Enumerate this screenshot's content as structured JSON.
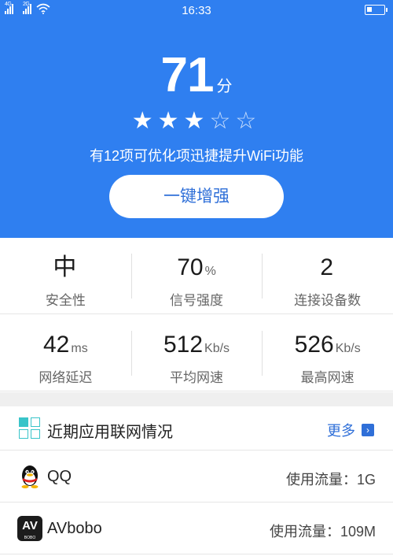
{
  "status_bar": {
    "network_1": "4G",
    "network_2": "2G",
    "time": "16:33"
  },
  "header": {
    "score": "71",
    "score_unit": "分",
    "rating": 3,
    "rating_max": 5,
    "tip": "有12项可优化项迅捷提升WiFi功能",
    "boost_label": "一键增强"
  },
  "stats": {
    "row1": [
      {
        "value": "中",
        "unit": "",
        "label": "安全性"
      },
      {
        "value": "70",
        "unit": "%",
        "label": "信号强度"
      },
      {
        "value": "2",
        "unit": "",
        "label": "连接设备数"
      }
    ],
    "row2": [
      {
        "value": "42",
        "unit": "ms",
        "label": "网络延迟"
      },
      {
        "value": "512",
        "unit": "Kb/s",
        "label": "平均网速"
      },
      {
        "value": "526",
        "unit": "Kb/s",
        "label": "最高网速"
      }
    ]
  },
  "recent": {
    "title": "近期应用联网情况",
    "more_label": "更多",
    "apps": [
      {
        "name": "QQ",
        "usage": "使用流量：1G",
        "icon": "qq-penguin-icon"
      },
      {
        "name": "AVbobo",
        "usage": "使用流量：109M",
        "icon": "avbobo-app-icon",
        "icon_text": "AV",
        "icon_subtext": "BOBO"
      }
    ]
  },
  "colors": {
    "header_bg": "#2f7ff0",
    "accent": "#2f6fd8",
    "grid_icon_teal": "#39c4c9"
  }
}
